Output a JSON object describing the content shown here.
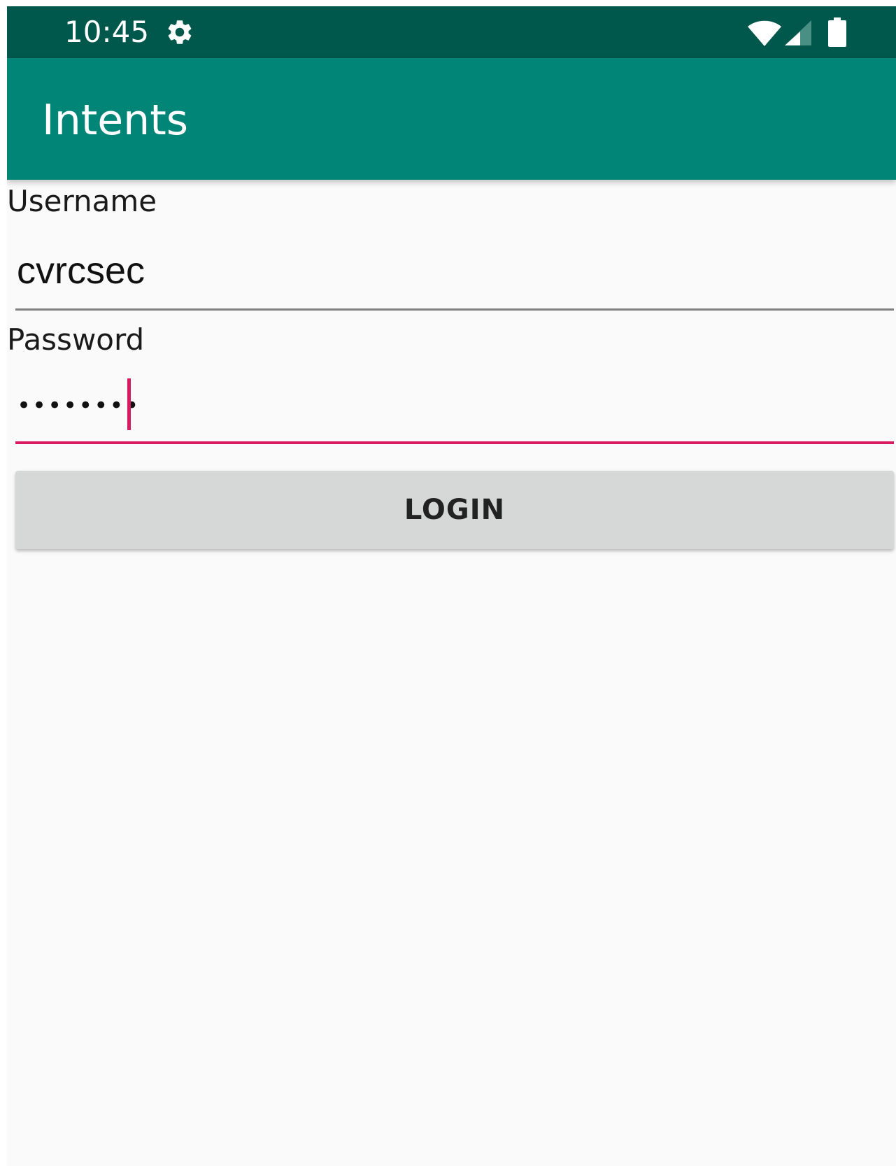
{
  "status_bar": {
    "time": "10:45",
    "icons": [
      "gear-icon",
      "wifi-icon",
      "cellular-signal-icon",
      "battery-icon"
    ],
    "background_color": "#00574b"
  },
  "app_bar": {
    "title": "Intents",
    "background_color": "#008577"
  },
  "form": {
    "username": {
      "label": "Username",
      "value": "cvrcsec"
    },
    "password": {
      "label": "Password",
      "masked_value": "••••••••",
      "focused": true
    },
    "login_button": {
      "label": "LOGIN"
    }
  },
  "colors": {
    "accent": "#d81b60",
    "screen_background": "#fafafa",
    "button_background": "#d6d7d7"
  }
}
